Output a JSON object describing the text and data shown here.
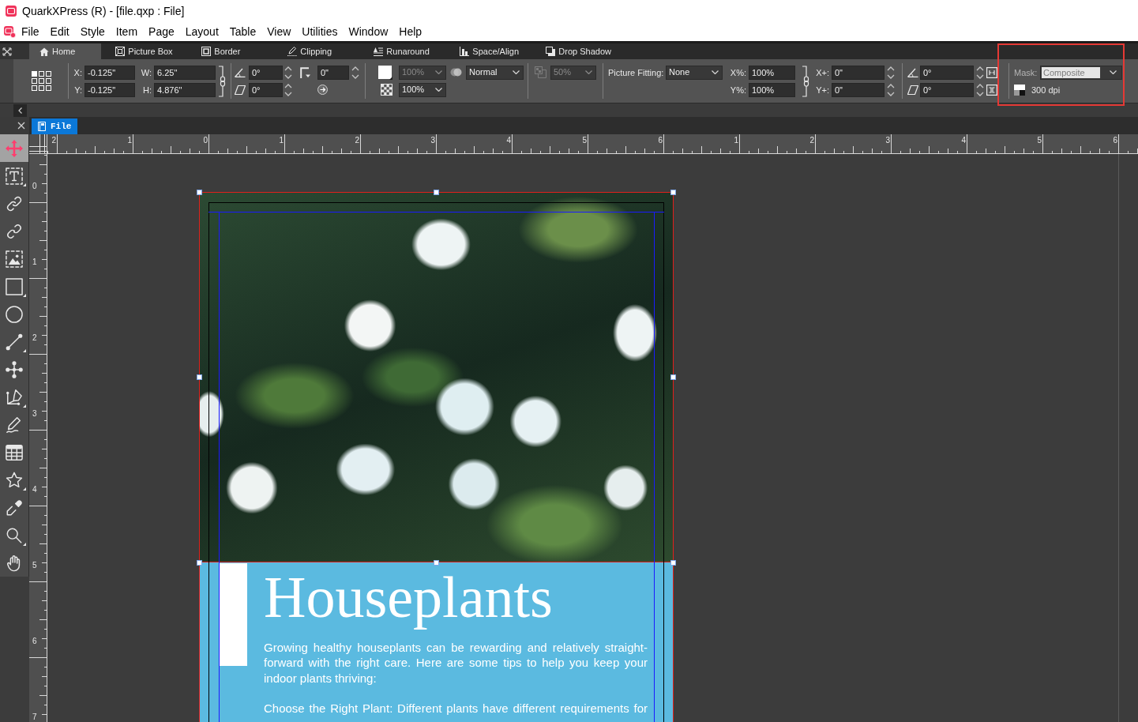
{
  "window": {
    "title": "QuarkXPress (R) - [file.qxp : File]"
  },
  "menu": [
    "File",
    "Edit",
    "Style",
    "Item",
    "Page",
    "Layout",
    "Table",
    "View",
    "Utilities",
    "Window",
    "Help"
  ],
  "ribbon_tabs": [
    {
      "kind": "home",
      "label": "Home",
      "selected": true
    },
    {
      "kind": "picture_box",
      "label": "Picture Box",
      "selected": false
    },
    {
      "kind": "border",
      "label": "Border",
      "selected": false
    },
    {
      "kind": "clipping",
      "label": "Clipping",
      "selected": false
    },
    {
      "kind": "runaround",
      "label": "Runaround",
      "selected": false
    },
    {
      "kind": "space_align",
      "label": "Space/Align",
      "selected": false
    },
    {
      "kind": "drop_shadow",
      "label": "Drop Shadow",
      "selected": false
    }
  ],
  "toolbar": {
    "geometry": [
      {
        "label": "X:",
        "value": "-0.125\""
      },
      {
        "label": "W:",
        "value": "6.25\""
      },
      {
        "label": "Y:",
        "value": "-0.125\""
      },
      {
        "label": "H:",
        "value": "4.876\""
      }
    ],
    "rotation": {
      "angle": "0°",
      "corner_radius": "0\"",
      "skew": "0°"
    },
    "fill": {
      "color": "#ffffff",
      "shade": "100%",
      "shade_disabled": true,
      "blend_mode": "Normal",
      "opacity": "100%"
    },
    "drop_shadow": {
      "opacity": "50%",
      "disabled": true
    },
    "picture": {
      "fitting_label": "Picture Fitting:",
      "fitting": "None",
      "scale": [
        {
          "label": "X%:",
          "value": "100%"
        },
        {
          "label": "Y%:",
          "value": "100%"
        }
      ],
      "offset": [
        {
          "label": "X+:",
          "value": "0\""
        },
        {
          "label": "Y+:",
          "value": "0\""
        }
      ],
      "angle": "0°",
      "skew": "0°"
    },
    "mask": {
      "label": "Mask:",
      "value": "Composite",
      "disabled": true,
      "highlighted": true
    },
    "resolution": "300 dpi"
  },
  "tools": [
    {
      "kind": "move",
      "selected": true,
      "flyout": false
    },
    {
      "kind": "text",
      "selected": false,
      "flyout": true
    },
    {
      "kind": "link",
      "selected": false,
      "flyout": false
    },
    {
      "kind": "unlink",
      "selected": false,
      "flyout": false
    },
    {
      "kind": "picture",
      "selected": false,
      "flyout": false
    },
    {
      "kind": "rectangle",
      "selected": false,
      "flyout": true
    },
    {
      "kind": "oval",
      "selected": false,
      "flyout": false
    },
    {
      "kind": "line",
      "selected": false,
      "flyout": true
    },
    {
      "kind": "bezier",
      "selected": false,
      "flyout": false
    },
    {
      "kind": "pen",
      "selected": false,
      "flyout": true
    },
    {
      "kind": "pencil",
      "selected": false,
      "flyout": false
    },
    {
      "kind": "table",
      "selected": false,
      "flyout": false
    },
    {
      "kind": "star",
      "selected": false,
      "flyout": true
    },
    {
      "kind": "eyedropper",
      "selected": false,
      "flyout": false
    },
    {
      "kind": "zoom",
      "selected": false,
      "flyout": true
    },
    {
      "kind": "pan",
      "selected": false,
      "flyout": false
    }
  ],
  "document_tabs": [
    {
      "label": "File",
      "selected": true
    }
  ],
  "horizontal_ruler": [
    "2",
    "1",
    "0",
    "1",
    "2",
    "3",
    "4",
    "5",
    "6",
    "1",
    "2",
    "3",
    "4",
    "5",
    "6"
  ],
  "vertical_ruler": [
    "0",
    "1",
    "2",
    "3",
    "4",
    "5",
    "6",
    "7"
  ],
  "page": {
    "picture_box": {
      "selected": true
    },
    "text_box": {
      "heading": "Houseplants",
      "paragraphs": [
        "Growing healthy houseplants can be rewarding and relatively straight-forward with the right care. Here are some tips to help you keep your indoor plants thriving:",
        "Choose the Right Plant: Different plants have different requirements for"
      ]
    }
  }
}
